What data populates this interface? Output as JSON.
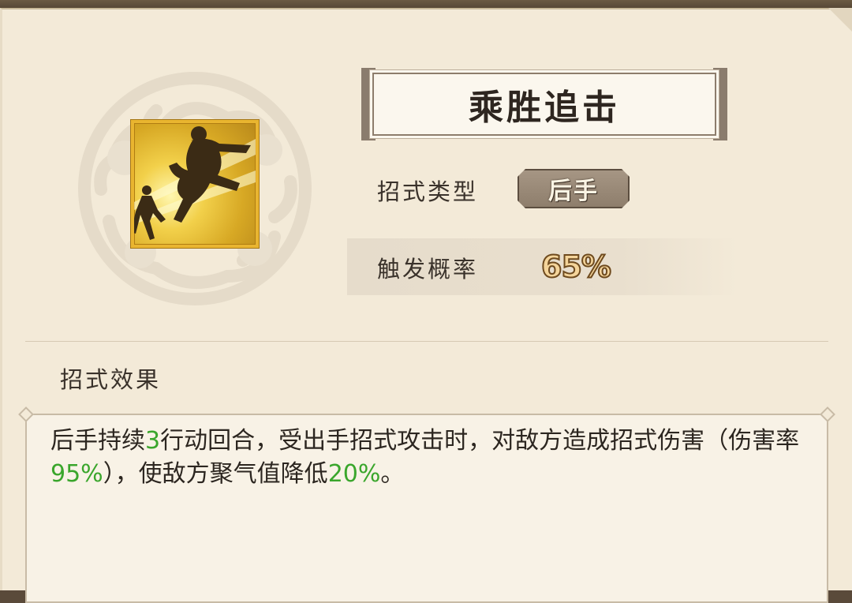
{
  "skill": {
    "name": "乘胜追击",
    "icon": "running-kick-icon",
    "type_label": "招式类型",
    "type_value": "后手",
    "rate_label": "触发概率",
    "rate_value": "65%"
  },
  "effect": {
    "title": "招式效果",
    "segments": [
      {
        "text": "后手持续",
        "highlight": false
      },
      {
        "text": "3",
        "highlight": true
      },
      {
        "text": "行动回合，受出手招式攻击时，对敌方造成招式伤害（伤害率",
        "highlight": false
      },
      {
        "text": "95%",
        "highlight": true
      },
      {
        "text": "），使敌方聚气值降低",
        "highlight": false
      },
      {
        "text": "20%",
        "highlight": true
      },
      {
        "text": "。",
        "highlight": false
      }
    ]
  },
  "colors": {
    "panel_bg": "#f3ead8",
    "highlight": "#3aa62c",
    "icon_border": "#e9b530"
  }
}
